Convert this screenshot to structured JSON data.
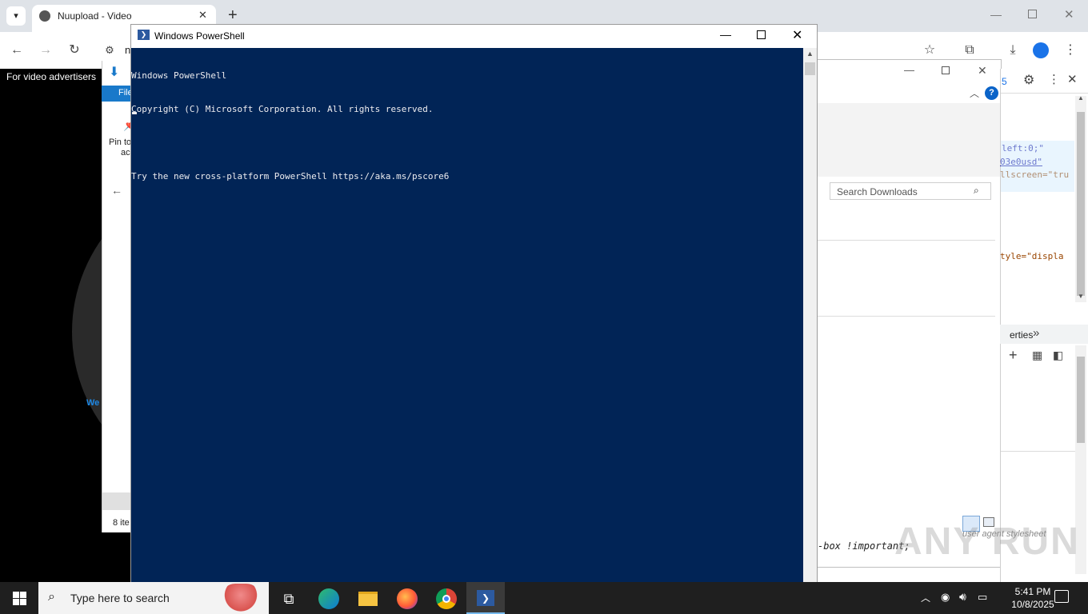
{
  "browser": {
    "tab_title": "Nuupload - Video",
    "new_tab": "+",
    "address_fragment": "n"
  },
  "page": {
    "advertisers_text": "For video advertisers",
    "partial_text": "We"
  },
  "explorer": {
    "file_tab": "File",
    "pin_line1": "Pin to",
    "pin_line2": "ac",
    "item_count": "8 ite"
  },
  "downloads": {
    "search_placeholder": "Search Downloads",
    "help_label": "?"
  },
  "devtools": {
    "count_fragment": "5",
    "code_lines": [
      {
        "text": "left:0;\"",
        "color": "#1a1aa6"
      },
      {
        "text": "03e0usd\"",
        "color": "#1a1aa6",
        "underline": true
      },
      {
        "text": "llscreen=\"tru",
        "color": "#994500"
      },
      {
        "text": "tyle=\"displa",
        "color": "#994500"
      }
    ],
    "properties_tab": "erties",
    "ua_stylesheet": "user agent stylesheet",
    "rule_text": "-box !important;"
  },
  "powershell": {
    "title": "Windows PowerShell",
    "lines": [
      "Windows PowerShell",
      "Copyright (C) Microsoft Corporation. All rights reserved.",
      "",
      "Try the new cross-platform PowerShell https://aka.ms/pscore6"
    ]
  },
  "taskbar": {
    "search_placeholder": "Type here to search",
    "time": "5:41 PM",
    "date": "10/8/2025"
  },
  "watermark": "ANY RUN"
}
